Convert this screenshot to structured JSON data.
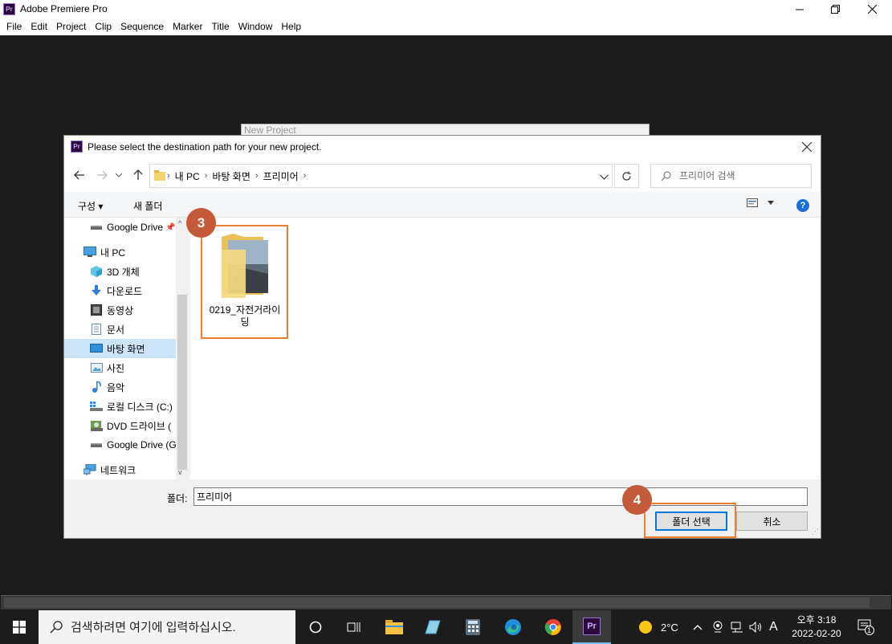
{
  "app": {
    "title": "Adobe Premiere Pro",
    "logo": "Pr",
    "menu": [
      "File",
      "Edit",
      "Project",
      "Clip",
      "Sequence",
      "Marker",
      "Title",
      "Window",
      "Help"
    ]
  },
  "new_project": {
    "title": "New Project"
  },
  "dialog": {
    "title": "Please select the destination path for your new project.",
    "logo": "Pr",
    "breadcrumb": [
      "내 PC",
      "바탕 화면",
      "프리미어"
    ],
    "search_placeholder": "프리미어 검색",
    "toolbar": {
      "organize": "구성 ▾",
      "new_folder": "새 폴더"
    },
    "nav_items": [
      {
        "label": "Google Drive",
        "icon": "drive-icon"
      },
      {
        "label": "내 PC",
        "icon": "pc-icon"
      },
      {
        "label": "3D 개체",
        "icon": "3d-objects-icon"
      },
      {
        "label": "다운로드",
        "icon": "download-icon"
      },
      {
        "label": "동영상",
        "icon": "video-icon"
      },
      {
        "label": "문서",
        "icon": "document-icon"
      },
      {
        "label": "바탕 화면",
        "icon": "desktop-icon",
        "selected": true
      },
      {
        "label": "사진",
        "icon": "pictures-icon"
      },
      {
        "label": "음악",
        "icon": "music-icon"
      },
      {
        "label": "로컬 디스크 (C:)",
        "icon": "local-disk-icon"
      },
      {
        "label": "DVD 드라이브 (",
        "icon": "dvd-drive-icon"
      },
      {
        "label": "Google Drive (G",
        "icon": "drive-icon"
      },
      {
        "label": "네트워크",
        "icon": "network-icon"
      }
    ],
    "folder": {
      "name": "0219_자전거라이딩"
    },
    "folder_label": "폴더:",
    "folder_value": "프리미어",
    "select_button": "폴더 선택",
    "cancel_button": "취소"
  },
  "annotations": [
    {
      "label": "3",
      "color": "#ed7d31"
    },
    {
      "label": "4",
      "color": "#ed7d31"
    }
  ],
  "taskbar": {
    "search_placeholder": "검색하려면 여기에 입력하십시오.",
    "apps": [
      "task-view-icon",
      "file-explorer-icon",
      "notes-icon",
      "calculator-icon",
      "edge-icon",
      "chrome-icon",
      "premiere-icon"
    ],
    "weather": "2°C",
    "ime": "A",
    "time": "오후 3:18",
    "date": "2022-02-20",
    "notifications": "1"
  }
}
